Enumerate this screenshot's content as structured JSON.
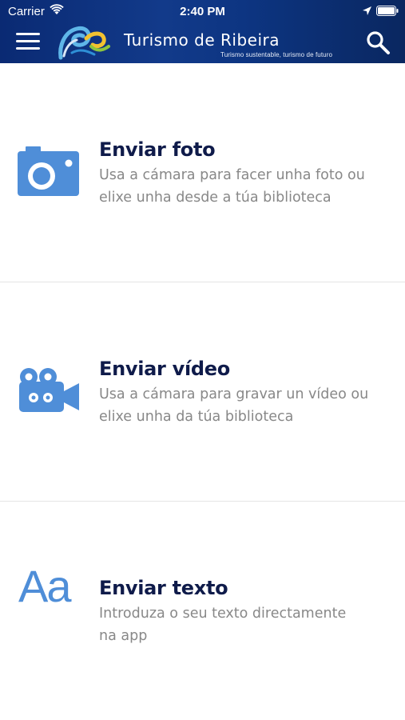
{
  "status_bar": {
    "carrier": "Carrier",
    "time": "2:40 PM"
  },
  "header": {
    "brand": "Turismo de Ribeira",
    "tagline": "Turismo sustentable, turismo de futuro",
    "menu_icon": "hamburger-menu-icon",
    "search_icon": "search-icon"
  },
  "options": [
    {
      "icon": "camera-icon",
      "title": "Enviar foto",
      "description_line1": "Usa a cámara para facer unha foto ou",
      "description_line2": "elixe unha desde a túa biblioteca"
    },
    {
      "icon": "video-camera-icon",
      "title": "Enviar vídeo",
      "description_line1": "Usa a cámara para gravar un vídeo ou",
      "description_line2": "elixe unha da túa biblioteca"
    },
    {
      "icon": "text-aa-icon",
      "icon_text": "Aa",
      "title": "Enviar texto",
      "description_line1": "Introduza o seu texto directamente",
      "description_line2": "na  app"
    }
  ],
  "colors": {
    "header_bg": "#0d3582",
    "icon_blue": "#4f8ed8",
    "title": "#0f1b4a",
    "description": "#888888"
  }
}
